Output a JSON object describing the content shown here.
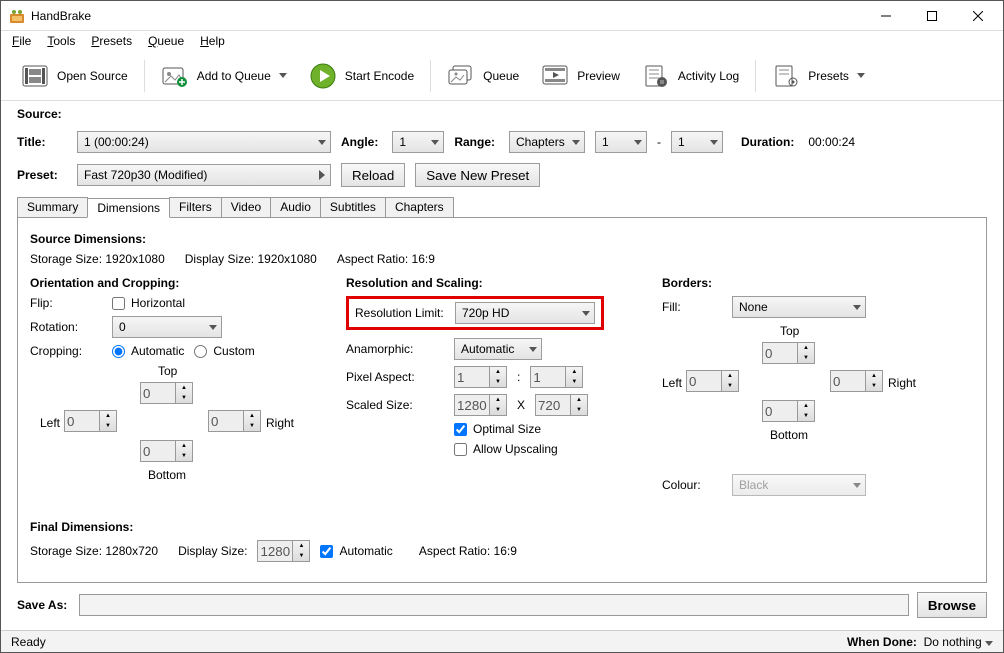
{
  "window": {
    "title": "HandBrake"
  },
  "menubar": {
    "file": "File",
    "tools": "Tools",
    "presets": "Presets",
    "queue": "Queue",
    "help": "Help"
  },
  "toolbar": {
    "open_source": "Open Source",
    "add_to_queue": "Add to Queue",
    "start_encode": "Start Encode",
    "queue": "Queue",
    "preview": "Preview",
    "activity_log": "Activity Log",
    "presets": "Presets"
  },
  "labels": {
    "source": "Source:",
    "title": "Title:",
    "angle": "Angle:",
    "range": "Range:",
    "duration": "Duration:",
    "preset": "Preset:",
    "reload": "Reload",
    "save_new_preset": "Save New Preset",
    "save_as": "Save As:",
    "browse": "Browse"
  },
  "source": {
    "title_value": "1  (00:00:24)",
    "angle_value": "1",
    "range_type": "Chapters",
    "range_from": "1",
    "range_dash": "-",
    "range_to": "1",
    "duration_value": "00:00:24"
  },
  "preset": {
    "value": "Fast 720p30  (Modified)"
  },
  "tabs": {
    "summary": "Summary",
    "dimensions": "Dimensions",
    "filters": "Filters",
    "video": "Video",
    "audio": "Audio",
    "subtitles": "Subtitles",
    "chapters": "Chapters"
  },
  "dims": {
    "source_dims_heading": "Source Dimensions:",
    "storage_size": "Storage Size: 1920x1080",
    "display_size": "Display Size: 1920x1080",
    "aspect_ratio": "Aspect Ratio: 16:9",
    "orientation_heading": "Orientation and Cropping:",
    "flip_label": "Flip:",
    "flip_horizontal": "Horizontal",
    "rotation_label": "Rotation:",
    "rotation_value": "0",
    "cropping_label": "Cropping:",
    "crop_auto": "Automatic",
    "crop_custom": "Custom",
    "top": "Top",
    "bottom": "Bottom",
    "left": "Left",
    "right": "Right",
    "crop_top": "0",
    "crop_bottom": "0",
    "crop_left": "0",
    "crop_right": "0",
    "res_scaling_heading": "Resolution and Scaling:",
    "res_limit_label": "Resolution Limit:",
    "res_limit_value": "720p HD",
    "anamorphic_label": "Anamorphic:",
    "anamorphic_value": "Automatic",
    "pixel_aspect_label": "Pixel Aspect:",
    "pixel_aspect_a": "1",
    "pixel_aspect_sep": ":",
    "pixel_aspect_b": "1",
    "scaled_size_label": "Scaled Size:",
    "scaled_w": "1280",
    "scaled_h": "720",
    "scaled_x": "X",
    "optimal_size": "Optimal Size",
    "allow_upscaling": "Allow Upscaling",
    "borders_heading": "Borders:",
    "fill_label": "Fill:",
    "fill_value": "None",
    "colour_label": "Colour:",
    "colour_value": "Black",
    "b_top": "0",
    "b_bottom": "0",
    "b_left": "0",
    "b_right": "0",
    "final_heading": "Final Dimensions:",
    "final_storage": "Storage Size: 1280x720",
    "final_display_label": "Display Size:",
    "final_display_value": "1280",
    "final_auto": "Automatic",
    "final_aspect": "Aspect Ratio: 16:9"
  },
  "status": {
    "ready": "Ready",
    "when_done_label": "When Done:",
    "when_done_value": "Do nothing"
  }
}
